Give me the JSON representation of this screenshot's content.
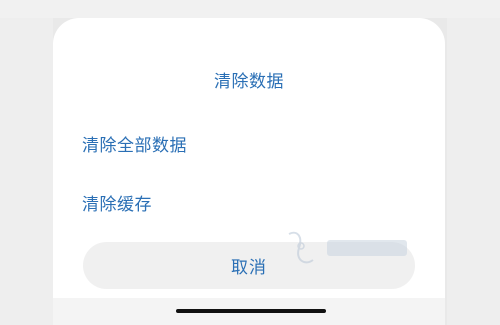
{
  "dialog": {
    "title": "清除数据",
    "options": [
      {
        "label": "清除全部数据"
      },
      {
        "label": "清除缓存"
      }
    ],
    "cancel_label": "取消"
  },
  "colors": {
    "accent": "#2a6fb5",
    "backdrop": "#e9e9e9",
    "sheet": "#ffffff",
    "cancel_bg": "#f0f0f0"
  }
}
